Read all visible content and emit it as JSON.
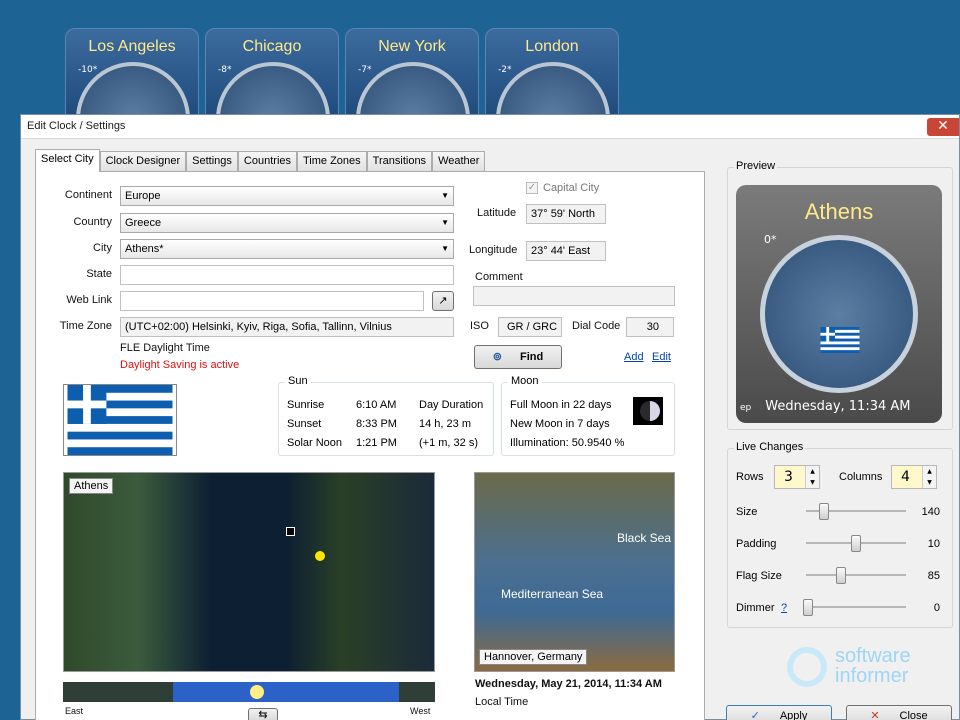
{
  "top_clocks": [
    {
      "city": "Los Angeles",
      "offset": "-10*"
    },
    {
      "city": "Chicago",
      "offset": "-8*"
    },
    {
      "city": "New York",
      "offset": "-7*"
    },
    {
      "city": "London",
      "offset": "-2*"
    }
  ],
  "window": {
    "title": "Edit Clock / Settings",
    "close": "✕"
  },
  "tabs": [
    "Select City",
    "Clock Designer",
    "Settings",
    "Countries",
    "Time Zones",
    "Transitions",
    "Weather"
  ],
  "form": {
    "continent_label": "Continent",
    "continent": "Europe",
    "country_label": "Country",
    "country": "Greece",
    "city_label": "City",
    "city": "Athens*",
    "state_label": "State",
    "state": "",
    "weblink_label": "Web Link",
    "weblink": "",
    "timezone_label": "Time Zone",
    "timezone": "(UTC+02:00) Helsinki, Kyiv, Riga, Sofia, Tallinn, Vilnius",
    "tz_name": "FLE Daylight Time",
    "dst_status": "Daylight Saving is active",
    "capital_label": "Capital City",
    "latitude_label": "Latitude",
    "latitude": "37° 59' North",
    "longitude_label": "Longitude",
    "longitude": "23° 44' East",
    "comment_label": "Comment",
    "comment": "",
    "iso_label": "ISO",
    "iso": "GR / GRC",
    "dial_label": "Dial Code",
    "dial": "30",
    "find_label": "Find",
    "add_label": "Add",
    "edit_label": "Edit"
  },
  "sun": {
    "title": "Sun",
    "sunrise_label": "Sunrise",
    "sunrise": "6:10 AM",
    "sunset_label": "Sunset",
    "sunset": "8:33 PM",
    "noon_label": "Solar Noon",
    "noon": "1:21 PM",
    "duration_label": "Day Duration",
    "duration": "14 h, 23 m",
    "duration_delta": "(+1 m, 32 s)"
  },
  "moon": {
    "title": "Moon",
    "full": "Full Moon in 22 days",
    "new": "New Moon in 7 days",
    "illumination": "Illumination: 50.9540 %"
  },
  "maps": {
    "world_label": "Athens",
    "region_label": "Hannover, Germany",
    "sea1": "Black Sea",
    "sea2": "Mediterranean Sea",
    "east": "East",
    "west": "West",
    "datetime": "Wednesday, May 21, 2014, 11:34 AM",
    "timetype": "Local Time"
  },
  "preview": {
    "title": "Preview",
    "city": "Athens",
    "offset": "0*",
    "footer": "Wednesday, 11:34 AM",
    "footer_prefix": "ep"
  },
  "live": {
    "title": "Live Changes",
    "rows_label": "Rows",
    "rows": "3",
    "cols_label": "Columns",
    "cols": "4",
    "size_label": "Size",
    "size": "140",
    "padding_label": "Padding",
    "padding": "10",
    "flag_label": "Flag Size",
    "flag": "85",
    "dimmer_label": "Dimmer",
    "dimmer_help": "?",
    "dimmer": "0",
    "size_level": 0.18,
    "padding_level": 0.5,
    "flag_level": 0.35,
    "dimmer_level": 0.02
  },
  "buttons": {
    "apply": "Apply",
    "close": "Close"
  },
  "watermark": {
    "line1": "software",
    "line2": "informer"
  },
  "colors": {
    "desktop": "#1d6394",
    "accent_yellow": "#ffe98a",
    "dst_red": "#dd1111"
  }
}
